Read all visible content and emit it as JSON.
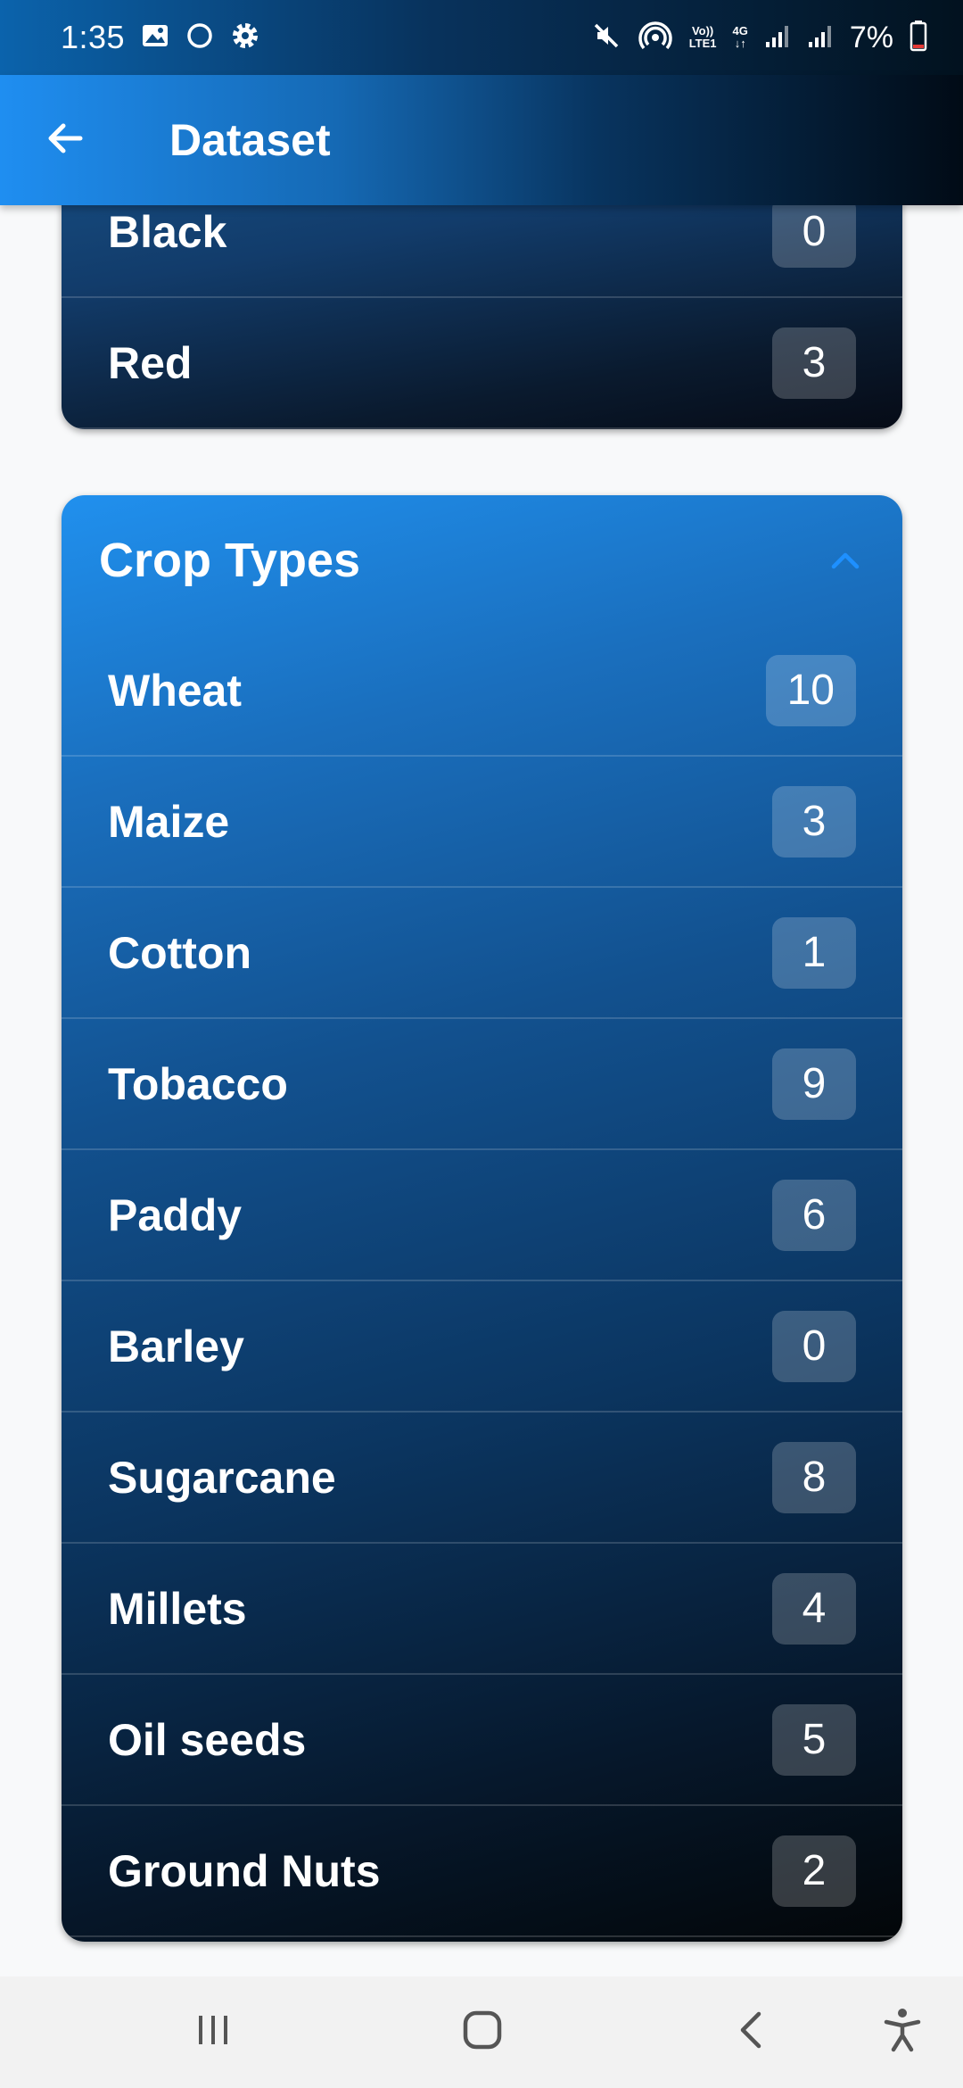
{
  "status_bar": {
    "time": "1:35",
    "network_label_top": "Vo))",
    "network_label_bottom": "LTE1",
    "network_type": "4G",
    "battery": "7%",
    "icons": [
      "image-icon",
      "circle-icon",
      "gear-icon",
      "mute-icon",
      "hotspot-icon",
      "signal-icon",
      "signal-icon",
      "battery-icon"
    ]
  },
  "app_bar": {
    "title": "Dataset",
    "back_icon": "arrow-left-icon"
  },
  "soil_section": {
    "items": [
      {
        "label": "Black",
        "count": "0"
      },
      {
        "label": "Red",
        "count": "3"
      }
    ]
  },
  "crop_section": {
    "title": "Crop Types",
    "expanded": true,
    "items": [
      {
        "label": "Wheat",
        "count": "10"
      },
      {
        "label": "Maize",
        "count": "3"
      },
      {
        "label": "Cotton",
        "count": "1"
      },
      {
        "label": "Tobacco",
        "count": "9"
      },
      {
        "label": "Paddy",
        "count": "6"
      },
      {
        "label": "Barley",
        "count": "0"
      },
      {
        "label": "Sugarcane",
        "count": "8"
      },
      {
        "label": "Millets",
        "count": "4"
      },
      {
        "label": "Oil seeds",
        "count": "5"
      },
      {
        "label": "Ground Nuts",
        "count": "2"
      }
    ]
  },
  "nav_bar": {
    "buttons": [
      "recent-apps-icon",
      "home-icon",
      "back-icon",
      "accessibility-icon"
    ]
  },
  "colors": {
    "accent": "#1f8ef1",
    "page_background": "#f8f9fa",
    "chevron": "#1e90ff"
  }
}
